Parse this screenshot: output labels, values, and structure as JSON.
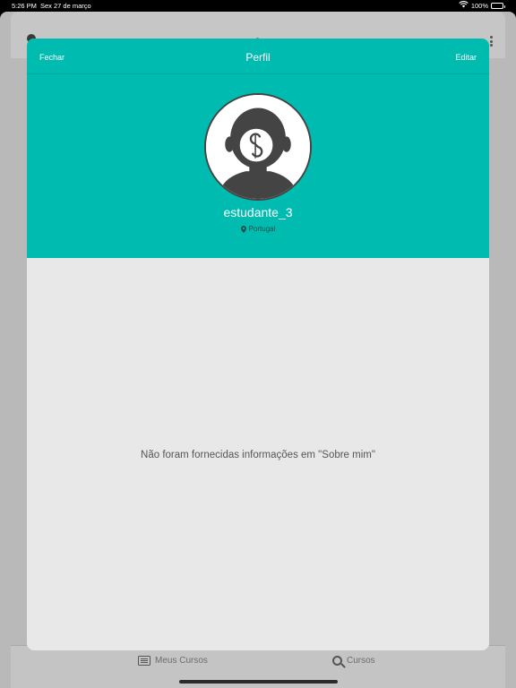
{
  "status_bar": {
    "time": "5:26 PM",
    "date": "Sex 27 de março",
    "battery": "100%",
    "battery_level": 1.0,
    "wifi_icon": "wifi-icon",
    "battery_icon": "battery-icon"
  },
  "background_app": {
    "tabs": [
      {
        "label": "Meus Cursos",
        "icon": "list-icon"
      },
      {
        "label": "Cursos",
        "icon": "search-icon"
      }
    ]
  },
  "modal": {
    "close_label": "Fechar",
    "title": "Perfil",
    "edit_label": "Editar",
    "profile": {
      "username": "estudante_3",
      "location": "Portugal",
      "avatar_icon": "default-avatar-icon",
      "location_icon": "location-pin-icon"
    },
    "about_empty_text": "Não foram fornecidas informações em \"Sobre mim\""
  },
  "colors": {
    "accent": "#00bbb0",
    "modal_body": "#e8e8e8",
    "avatar_silhouette": "#444444",
    "text_muted": "#555555"
  }
}
